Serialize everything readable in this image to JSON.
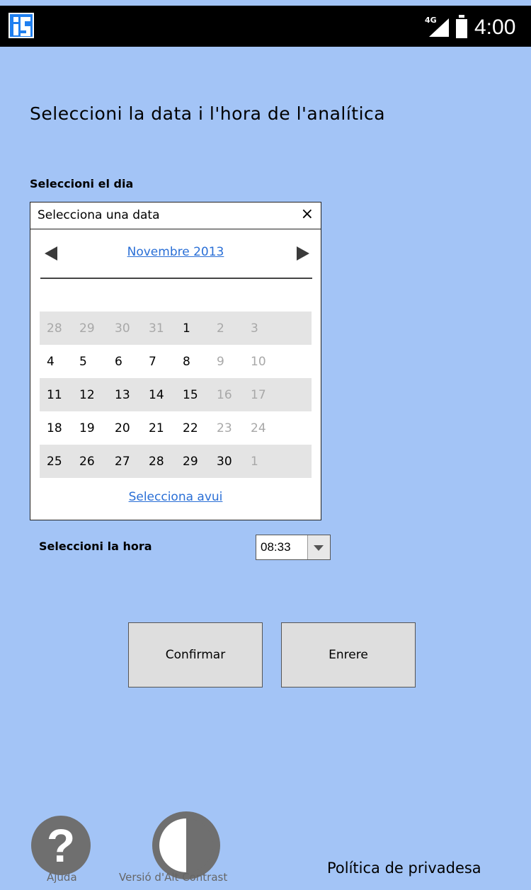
{
  "status_bar": {
    "network": "4G",
    "time": "4:00"
  },
  "page": {
    "title": "Seleccioni  la data i l'hora  de l'analítica",
    "day_label": "Seleccioni el  dia",
    "hour_label": "Seleccioni la hora"
  },
  "datepicker": {
    "header": "Selecciona una data",
    "close": "×",
    "month": "Novembre 2013",
    "today_link": "Selecciona avui",
    "weeks": [
      [
        {
          "d": "28",
          "muted": true
        },
        {
          "d": "29",
          "muted": true
        },
        {
          "d": "30",
          "muted": true
        },
        {
          "d": "31",
          "muted": true
        },
        {
          "d": "1",
          "muted": false
        },
        {
          "d": "2",
          "muted": true
        },
        {
          "d": "3",
          "muted": true
        }
      ],
      [
        {
          "d": "4",
          "muted": false
        },
        {
          "d": "5",
          "muted": false
        },
        {
          "d": "6",
          "muted": false
        },
        {
          "d": "7",
          "muted": false
        },
        {
          "d": "8",
          "muted": false
        },
        {
          "d": "9",
          "muted": true
        },
        {
          "d": "10",
          "muted": true
        }
      ],
      [
        {
          "d": "11",
          "muted": false
        },
        {
          "d": "12",
          "muted": false
        },
        {
          "d": "13",
          "muted": false
        },
        {
          "d": "14",
          "muted": false
        },
        {
          "d": "15",
          "muted": false
        },
        {
          "d": "16",
          "muted": true
        },
        {
          "d": "17",
          "muted": true
        }
      ],
      [
        {
          "d": "18",
          "muted": false
        },
        {
          "d": "19",
          "muted": false
        },
        {
          "d": "20",
          "muted": false
        },
        {
          "d": "21",
          "muted": false
        },
        {
          "d": "22",
          "muted": false
        },
        {
          "d": "23",
          "muted": true
        },
        {
          "d": "24",
          "muted": true
        }
      ],
      [
        {
          "d": "25",
          "muted": false
        },
        {
          "d": "26",
          "muted": false
        },
        {
          "d": "27",
          "muted": false
        },
        {
          "d": "28",
          "muted": false
        },
        {
          "d": "29",
          "muted": false
        },
        {
          "d": "30",
          "muted": false
        },
        {
          "d": "1",
          "muted": true
        }
      ]
    ]
  },
  "time_select": {
    "value": "08:33"
  },
  "buttons": {
    "confirm": "Confirmar",
    "back": "Enrere"
  },
  "footer": {
    "help_symbol": "?",
    "help": "Ajuda",
    "contrast": "Versió d'Alt Contrast",
    "privacy": "Política de privadesa"
  },
  "colors": {
    "background": "#a3c4f6",
    "link": "#2a6fd6",
    "icon_grey": "#6f6f6f"
  }
}
